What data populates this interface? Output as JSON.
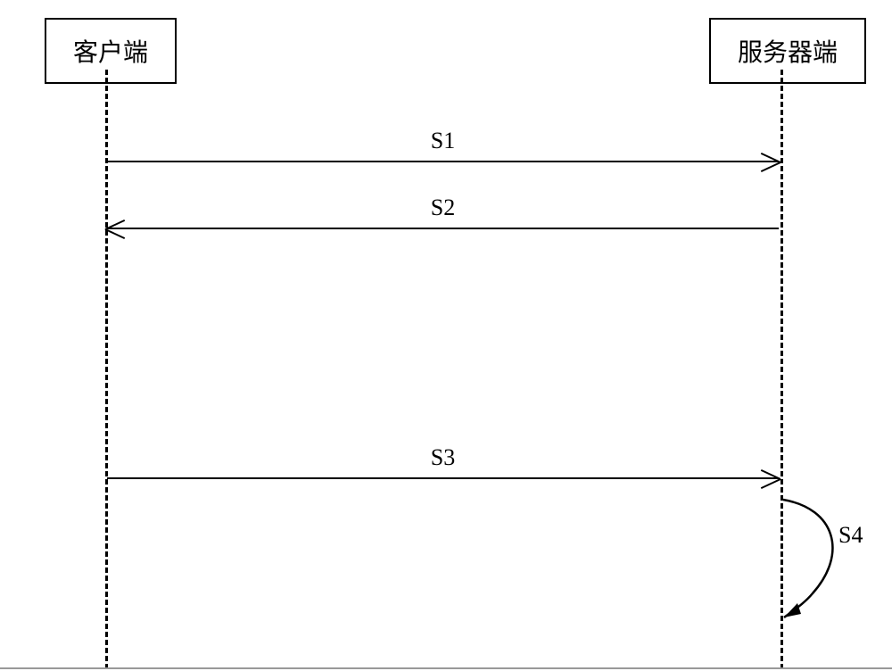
{
  "participants": {
    "client": "客户端",
    "server": "服务器端"
  },
  "messages": {
    "s1": "S1",
    "s2": "S2",
    "s3": "S3",
    "s4": "S4"
  },
  "chart_data": {
    "type": "sequence-diagram",
    "participants": [
      {
        "id": "client",
        "label": "客户端"
      },
      {
        "id": "server",
        "label": "服务器端"
      }
    ],
    "messages": [
      {
        "from": "client",
        "to": "server",
        "label": "S1"
      },
      {
        "from": "server",
        "to": "client",
        "label": "S2"
      },
      {
        "from": "client",
        "to": "server",
        "label": "S3"
      },
      {
        "from": "server",
        "to": "server",
        "label": "S4",
        "self": true
      }
    ]
  }
}
